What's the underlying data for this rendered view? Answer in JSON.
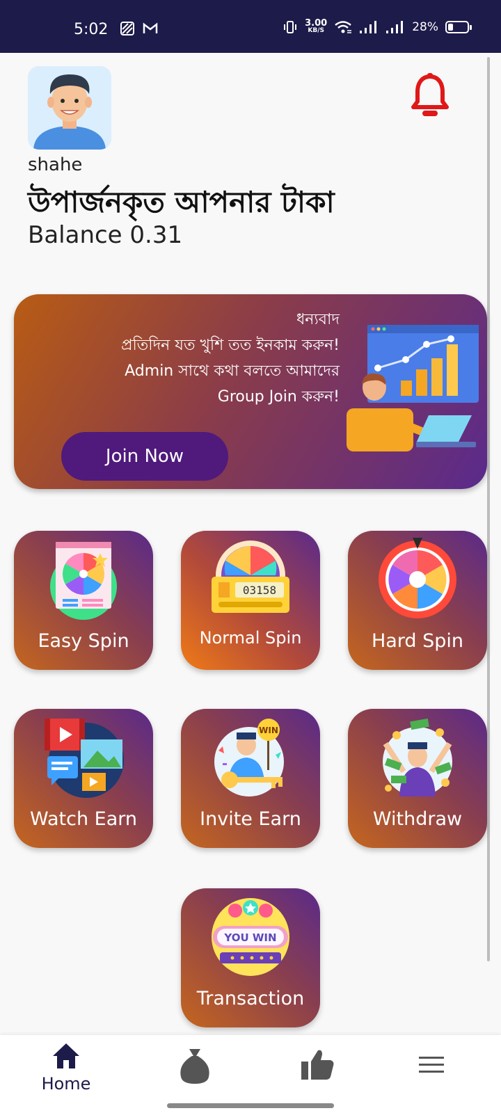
{
  "status_bar": {
    "time": "5:02",
    "net_speed_value": "3.00",
    "net_speed_unit": "KB/S",
    "battery_percent": "28%",
    "battery_level": 0.28
  },
  "profile": {
    "username": "shahe",
    "headline": "উপার্জনকৃত আপনার টাকা",
    "balance": "Balance 0.31"
  },
  "banner": {
    "line1": "ধন্যবাদ",
    "line2": "প্রতিদিন যত খুশি তত ইনকাম করুন!",
    "line3": "Admin সাথে কথা বলতে আমাদের",
    "line4": "Group Join করুন!",
    "button_label": "Join Now"
  },
  "tiles": [
    {
      "label": "Easy Spin",
      "icon": "spin-wheel-browser-icon"
    },
    {
      "label": "Normal Spin",
      "icon": "slot-machine-icon"
    },
    {
      "label": "Hard Spin",
      "icon": "color-wheel-icon"
    },
    {
      "label": "Watch Earn",
      "icon": "video-media-icon"
    },
    {
      "label": "Invite Earn",
      "icon": "winner-key-icon"
    },
    {
      "label": "Withdraw",
      "icon": "money-rain-icon"
    },
    {
      "label": "Transaction",
      "icon": "you-win-sign-icon"
    }
  ],
  "you_win_text": "YOU WIN",
  "win_badge_text": "WIN",
  "slot_digits": "03158",
  "bottom_nav": {
    "home_label": "Home"
  },
  "colors": {
    "status_bar": "#1d1b4a",
    "bell": "#e01818",
    "join_button": "#4f1a7c",
    "nav_icon": "#1d1b4a"
  }
}
